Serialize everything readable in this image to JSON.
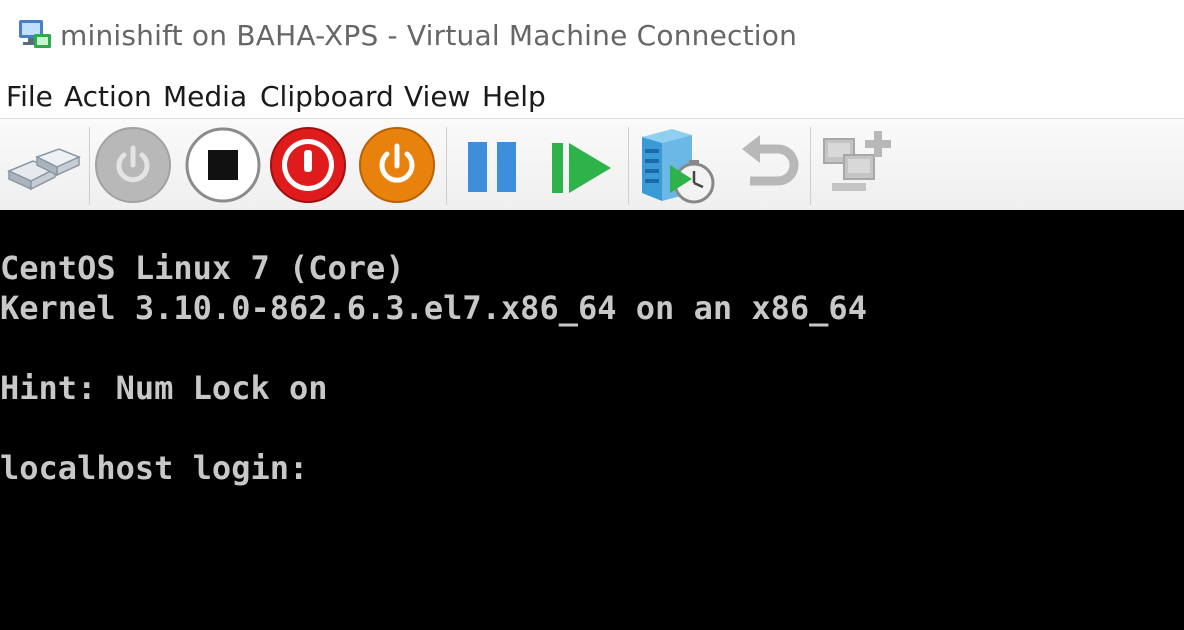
{
  "window": {
    "title": "minishift on BAHA-XPS - Virtual Machine Connection",
    "icon": "vm-connection-icon"
  },
  "menu": {
    "items": [
      {
        "label": "File"
      },
      {
        "label": "Action"
      },
      {
        "label": "Media"
      },
      {
        "label": "Clipboard"
      },
      {
        "label": "View"
      },
      {
        "label": "Help"
      }
    ]
  },
  "toolbar": {
    "buttons": [
      {
        "name": "ctrl-alt-del-button",
        "icon": "keyboard-keys-icon",
        "enabled": true
      },
      {
        "name": "start-button",
        "icon": "power-icon",
        "enabled": false
      },
      {
        "name": "turn-off-button",
        "icon": "stop-icon",
        "enabled": true
      },
      {
        "name": "shut-down-button",
        "icon": "power-red-icon",
        "enabled": true
      },
      {
        "name": "save-button",
        "icon": "power-orange-icon",
        "enabled": true
      },
      {
        "name": "pause-button",
        "icon": "pause-icon",
        "enabled": true
      },
      {
        "name": "resume-button",
        "icon": "resume-icon",
        "enabled": true
      },
      {
        "name": "checkpoint-button",
        "icon": "checkpoint-icon",
        "enabled": true
      },
      {
        "name": "revert-button",
        "icon": "undo-icon",
        "enabled": false
      },
      {
        "name": "enhanced-session-button",
        "icon": "enhanced-session-icon",
        "enabled": false
      }
    ],
    "colors": {
      "red": "#e01b1b",
      "orange": "#e8820c",
      "blue": "#3d8fdc",
      "green": "#2db34a",
      "disabled": "#b8b8b8"
    }
  },
  "console": {
    "lines": [
      "CentOS Linux 7 (Core)",
      "Kernel 3.10.0-862.6.3.el7.x86_64 on an x86_64",
      "",
      "Hint: Num Lock on",
      "",
      "localhost login:"
    ],
    "background": "#000000",
    "foreground": "#c8c8c8"
  }
}
